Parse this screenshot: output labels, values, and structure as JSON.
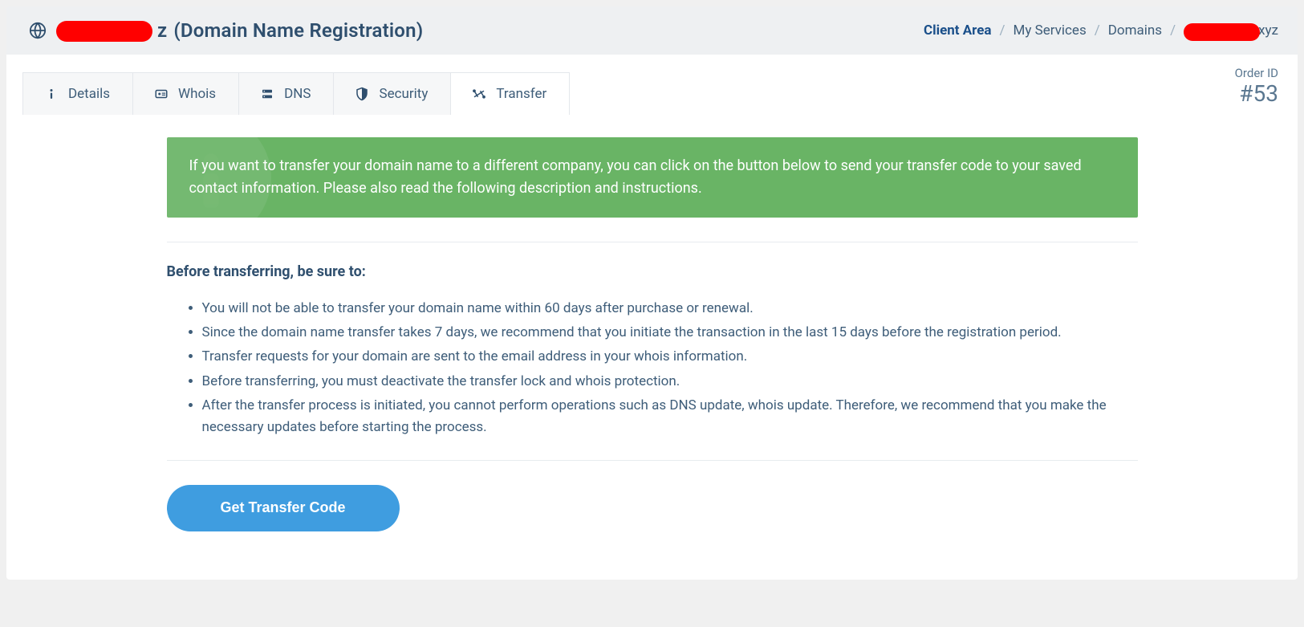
{
  "header": {
    "domain_suffix": "z",
    "title_paren": "(Domain Name Registration)"
  },
  "breadcrumb": {
    "items": [
      {
        "label": "Client Area",
        "active": true
      },
      {
        "label": "My Services",
        "active": false
      },
      {
        "label": "Domains",
        "active": false
      }
    ],
    "tail_suffix": "xyz"
  },
  "tabs": {
    "details": "Details",
    "whois": "Whois",
    "dns": "DNS",
    "security": "Security",
    "transfer": "Transfer"
  },
  "order": {
    "label": "Order ID",
    "number": "#53"
  },
  "alert": {
    "text": "If you want to transfer your domain name to a different company, you can click on the button below to send your transfer code to your saved contact information. Please also read the following description and instructions."
  },
  "section": {
    "title": "Before transferring, be sure to:",
    "items": [
      "You will not be able to transfer your domain name within 60 days after purchase or renewal.",
      "Since the domain name transfer takes 7 days, we recommend that you initiate the transaction in the last 15 days before the registration period.",
      "Transfer requests for your domain are sent to the email address in your whois information.",
      "Before transferring, you must deactivate the transfer lock and whois protection.",
      "After the transfer process is initiated, you cannot perform operations such as DNS update, whois update. Therefore, we recommend that you make the necessary updates before starting the process."
    ]
  },
  "actions": {
    "get_transfer_code": "Get Transfer Code"
  }
}
